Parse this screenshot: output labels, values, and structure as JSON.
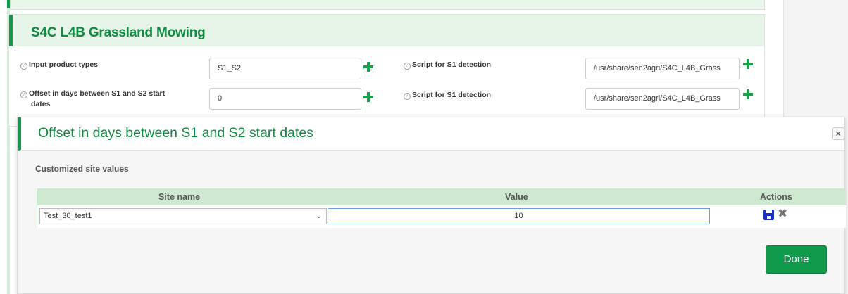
{
  "top_panel": {},
  "grassland_panel": {
    "title": "S4C L4B Grassland Mowing",
    "fields": [
      {
        "label": "Input product types",
        "value": "S1_S2"
      },
      {
        "label_line1": "Offset in days between S1 and S2 start",
        "label_line2": "dates",
        "value": "0"
      }
    ],
    "right_fields": [
      {
        "label": "Script for S1 detection",
        "value": "/usr/share/sen2agri/S4C_L4B_Grass"
      },
      {
        "label": "Script for S1 detection",
        "value": "/usr/share/sen2agri/S4C_L4B_Grass"
      }
    ]
  },
  "modal": {
    "title": "Offset in days between S1 and S2 start dates",
    "close_label": "×",
    "section_label": "Customized site values",
    "table": {
      "columns": [
        "Site name",
        "Value",
        "Actions"
      ],
      "rows": [
        {
          "site_name": "Test_30_test1",
          "value": "10"
        }
      ]
    },
    "done_label": "Done"
  },
  "icons": {
    "info": "info-icon",
    "plus": "plus-icon",
    "save": "save-icon",
    "delete": "delete-icon",
    "chevron": "chevron-down-icon",
    "close": "close-icon"
  },
  "colors": {
    "accent_green": "#0f9b4b",
    "header_green": "#e7f5e8",
    "table_head": "#cfe8d0",
    "save_blue": "#1a2fc4"
  }
}
